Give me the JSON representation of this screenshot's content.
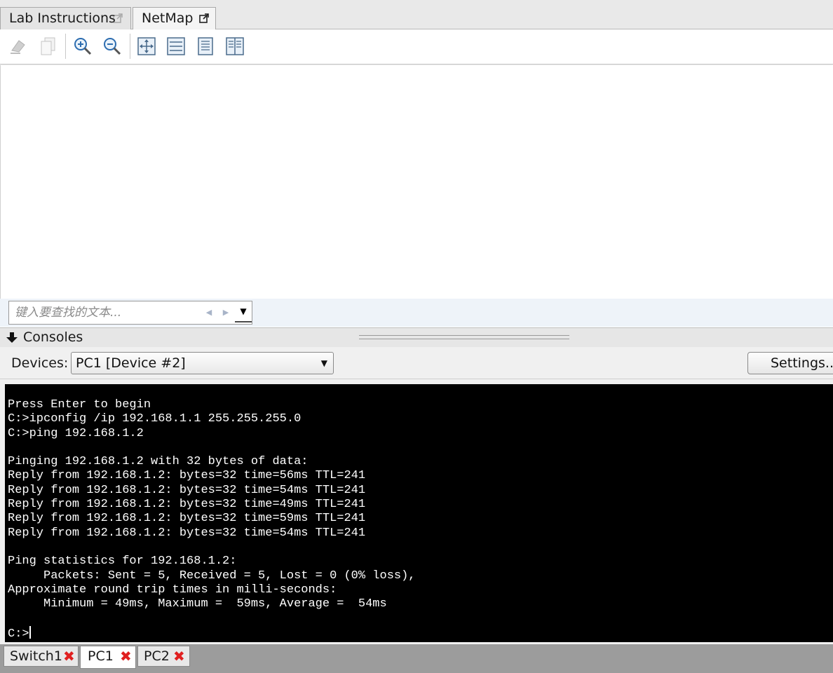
{
  "top_tabs": [
    {
      "label": "Lab Instructions"
    },
    {
      "label": "NetMap"
    }
  ],
  "toolbar": {
    "icons": [
      "eraser-icon",
      "copy-icon",
      "zoom-in-icon",
      "zoom-out-icon",
      "fit-icon",
      "page-width-icon",
      "single-page-icon",
      "two-page-icon"
    ]
  },
  "find": {
    "placeholder": "键入要查找的文本..."
  },
  "consoles": {
    "title": "Consoles"
  },
  "devices": {
    "label": "Devices:",
    "selected": "PC1 [Device #2]",
    "settings_label": "Settings..."
  },
  "terminal": {
    "lines": [
      "Press Enter to begin",
      "C:>ipconfig /ip 192.168.1.1 255.255.255.0",
      "C:>ping 192.168.1.2",
      "",
      "Pinging 192.168.1.2 with 32 bytes of data:",
      "Reply from 192.168.1.2: bytes=32 time=56ms TTL=241",
      "Reply from 192.168.1.2: bytes=32 time=54ms TTL=241",
      "Reply from 192.168.1.2: bytes=32 time=49ms TTL=241",
      "Reply from 192.168.1.2: bytes=32 time=59ms TTL=241",
      "Reply from 192.168.1.2: bytes=32 time=54ms TTL=241",
      "",
      "Ping statistics for 192.168.1.2:",
      "     Packets: Sent = 5, Received = 5, Lost = 0 (0% loss),",
      "Approximate round trip times in milli-seconds:",
      "     Minimum = 49ms, Maximum =  59ms, Average =  54ms",
      ""
    ],
    "prompt": "C:>"
  },
  "device_tabs": [
    {
      "label": "Switch1",
      "active": false
    },
    {
      "label": "PC1",
      "active": true
    },
    {
      "label": "PC2",
      "active": false
    }
  ],
  "colors": {
    "terminal_bg": "#000000",
    "terminal_fg": "#ffffff",
    "close_x": "#e02020"
  }
}
